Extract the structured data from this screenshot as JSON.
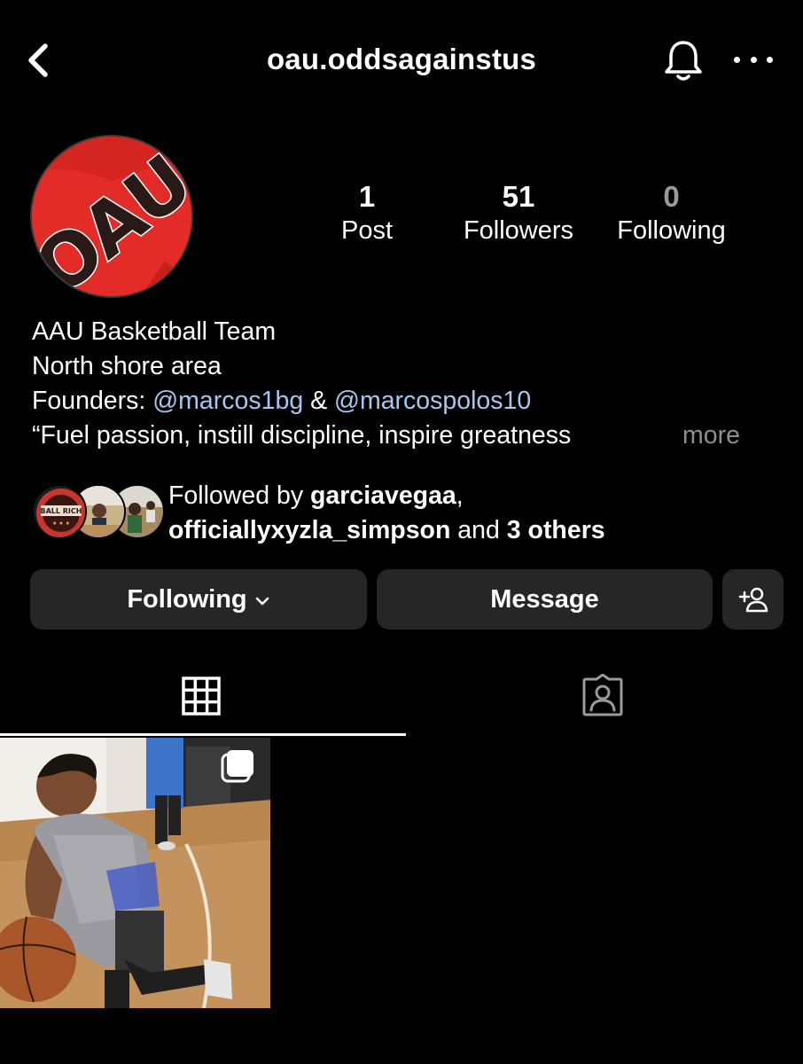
{
  "header": {
    "username": "oau.oddsagainstus",
    "back_icon": "chevron-left-icon",
    "bell_icon": "bell-icon",
    "more_icon": "more-horizontal-icon"
  },
  "avatar": {
    "logo_text": "OAU",
    "color": "#e32b27"
  },
  "stats": {
    "posts": {
      "count": "1",
      "label": "Post"
    },
    "followers": {
      "count": "51",
      "label": "Followers"
    },
    "following": {
      "count": "0",
      "label": "Following"
    }
  },
  "bio": {
    "line1": "AAU Basketball Team",
    "line2": "North shore area",
    "founders_prefix": "Founders: ",
    "mention1": "@marcos1bg",
    "amp": " & ",
    "mention2": "@marcospolos10",
    "line4": "“Fuel passion, instill discipline, inspire greatness",
    "more": "more"
  },
  "followed_by": {
    "prefix": "Followed by ",
    "user1": "garciavegaa",
    "comma": ",",
    "user2": "officiallyxyzla_simpson",
    "and": " and ",
    "others": "3 others",
    "avatar1_text": "BALL RICH"
  },
  "actions": {
    "following_label": "Following",
    "message_label": "Message",
    "add_user_icon": "add-user-icon"
  },
  "tabs": {
    "grid_icon": "grid-icon",
    "tagged_icon": "tagged-icon",
    "active": "grid"
  },
  "colors": {
    "background": "#000000",
    "button": "#262626",
    "mention": "#a5c8f0",
    "muted": "#8e8e8e"
  }
}
